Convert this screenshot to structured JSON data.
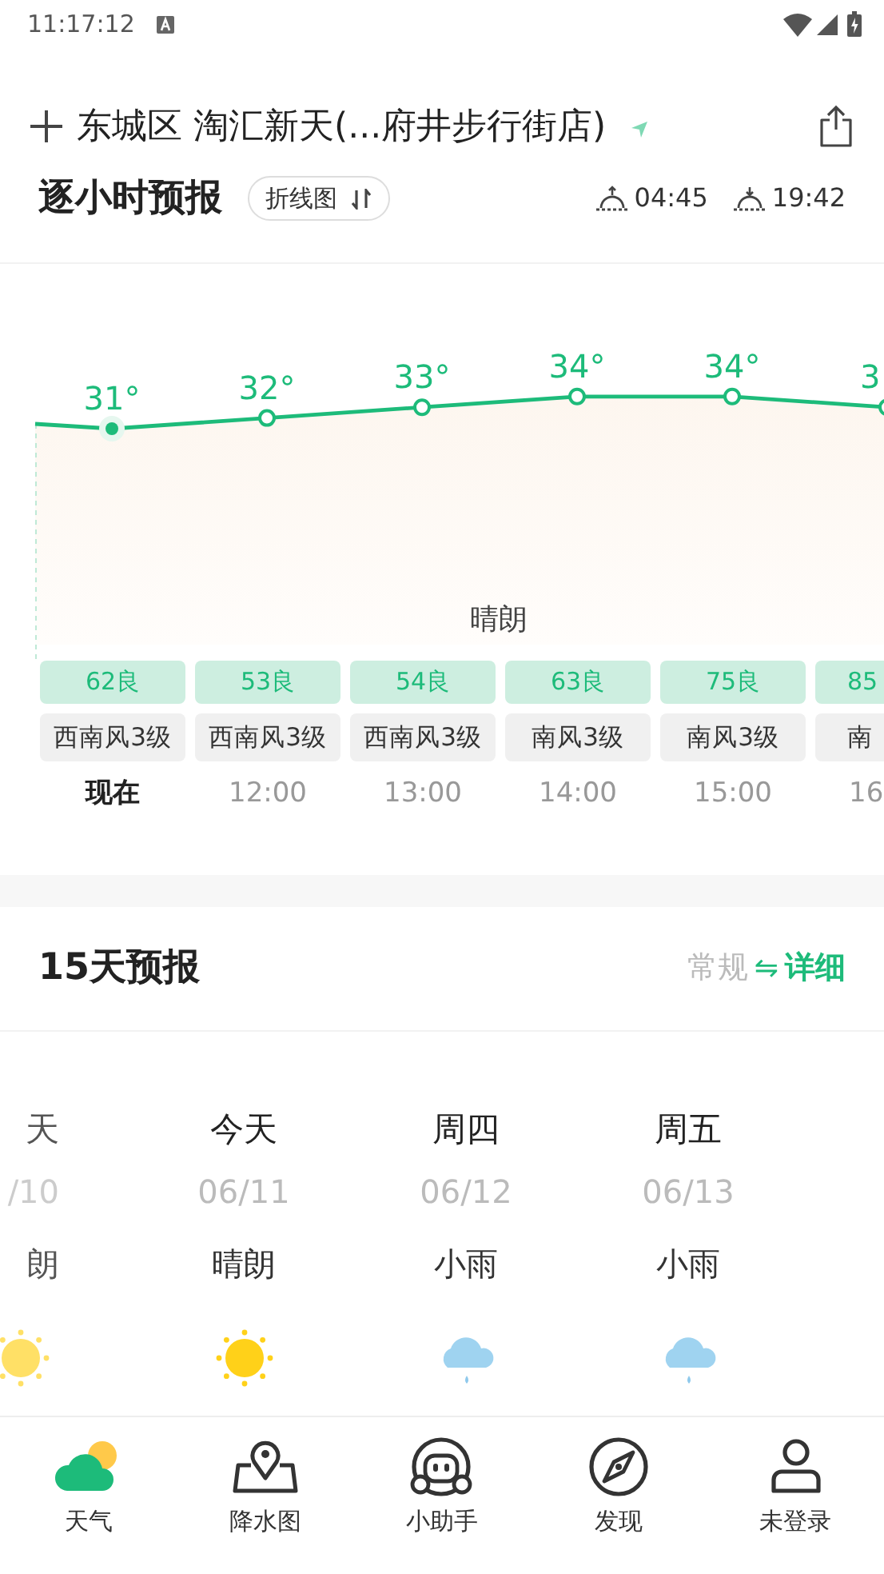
{
  "status_bar": {
    "time": "11:17:12"
  },
  "location": {
    "title": "东城区 淘汇新天(...府井步行街店)"
  },
  "hourly": {
    "title": "逐小时预报",
    "view_button": "折线图",
    "sunrise": "04:45",
    "sunset": "19:42",
    "condition": "晴朗",
    "hours": [
      {
        "temp": "31°",
        "aqi": "62良",
        "wind": "西南风3级",
        "time": "现在",
        "selected": true
      },
      {
        "temp": "32°",
        "aqi": "53良",
        "wind": "西南风3级",
        "time": "12:00",
        "selected": false
      },
      {
        "temp": "33°",
        "aqi": "54良",
        "wind": "西南风3级",
        "time": "13:00",
        "selected": false
      },
      {
        "temp": "34°",
        "aqi": "63良",
        "wind": "南风3级",
        "time": "14:00",
        "selected": false
      },
      {
        "temp": "34°",
        "aqi": "75良",
        "wind": "南风3级",
        "time": "15:00",
        "selected": false
      },
      {
        "temp": "3",
        "aqi": "85",
        "wind": "南",
        "time": "16",
        "selected": false
      }
    ]
  },
  "daily": {
    "title": "15天预报",
    "modes": [
      {
        "label": "常规",
        "selected": false
      },
      {
        "label": "详细",
        "selected": true
      }
    ],
    "swap": "⇋",
    "days": [
      {
        "day": "天",
        "date": "/10",
        "weather": "朗",
        "kind": "sun",
        "past": true
      },
      {
        "day": "今天",
        "date": "06/11",
        "weather": "晴朗",
        "kind": "sun",
        "past": false
      },
      {
        "day": "周四",
        "date": "06/12",
        "weather": "小雨",
        "kind": "rain",
        "past": false
      },
      {
        "day": "周五",
        "date": "06/13",
        "weather": "小雨",
        "kind": "rain",
        "past": false
      }
    ]
  },
  "nav": [
    {
      "label": "天气",
      "kind": "weather",
      "selected": true
    },
    {
      "label": "降水图",
      "kind": "map",
      "selected": false
    },
    {
      "label": "小助手",
      "kind": "robot",
      "selected": false
    },
    {
      "label": "发现",
      "kind": "compass",
      "selected": false
    },
    {
      "label": "未登录",
      "kind": "user",
      "selected": false
    }
  ]
}
